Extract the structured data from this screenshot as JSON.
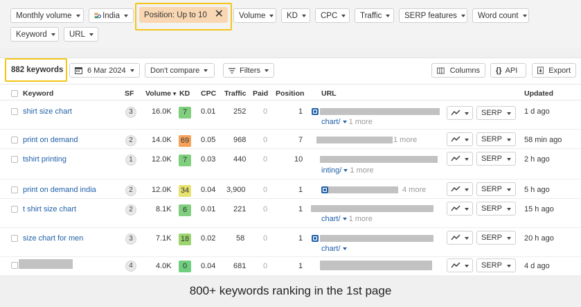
{
  "filters": {
    "monthly_volume": "Monthly volume",
    "country": "India",
    "position": "Position: Up to 10",
    "volume": "Volume",
    "kd": "KD",
    "cpc": "CPC",
    "traffic": "Traffic",
    "serp_features": "SERP features",
    "word_count": "Word count",
    "keyword": "Keyword",
    "url": "URL"
  },
  "toolbar": {
    "keyword_count": "882 keywords",
    "date": "6 Mar 2024",
    "compare": "Don't compare",
    "filters": "Filters",
    "columns": "Columns",
    "api": "API",
    "export": "Export"
  },
  "columns": [
    "Keyword",
    "SF",
    "Volume",
    "KD",
    "CPC",
    "Traffic",
    "Paid",
    "Position",
    "URL",
    "Updated"
  ],
  "rows": [
    {
      "keyword": "shirt size chart",
      "sf": "3",
      "volume": "16.0K",
      "kd": "7",
      "kd_color": "#7fcf7f",
      "cpc": "0.01",
      "traffic": "252",
      "paid": "0",
      "position": "1",
      "url_line2": "chart/",
      "more": "1 more",
      "updated": "1 d ago"
    },
    {
      "keyword": "print on demand",
      "sf": "2",
      "volume": "14.0K",
      "kd": "69",
      "kd_color": "#f5a35c",
      "cpc": "0.05",
      "traffic": "968",
      "paid": "0",
      "position": "7",
      "url_line2": "",
      "more": "1 more",
      "updated": "58 min ago"
    },
    {
      "keyword": "tshirt printing",
      "sf": "1",
      "volume": "12.0K",
      "kd": "7",
      "kd_color": "#7fcf7f",
      "cpc": "0.03",
      "traffic": "440",
      "paid": "0",
      "position": "10",
      "url_line2": "inting/",
      "more": "1 more",
      "updated": "2 h ago"
    },
    {
      "keyword": "print on demand india",
      "sf": "2",
      "volume": "12.0K",
      "kd": "34",
      "kd_color": "#e6e270",
      "cpc": "0.04",
      "traffic": "3,900",
      "paid": "0",
      "position": "1",
      "url_line2": "",
      "more": "4 more",
      "updated": "5 h ago"
    },
    {
      "keyword": "t shirt size chart",
      "sf": "2",
      "volume": "8.1K",
      "kd": "6",
      "kd_color": "#7fcf7f",
      "cpc": "0.01",
      "traffic": "221",
      "paid": "0",
      "position": "1",
      "url_line2": "chart/",
      "more": "1 more",
      "updated": "15 h ago"
    },
    {
      "keyword": "size chart for men",
      "sf": "3",
      "volume": "7.1K",
      "kd": "18",
      "kd_color": "#9bd66f",
      "cpc": "0.02",
      "traffic": "58",
      "paid": "0",
      "position": "1",
      "url_line2": "chart/",
      "more": "",
      "updated": "20 h ago"
    },
    {
      "keyword": "",
      "sf": "4",
      "volume": "4.0K",
      "kd": "0",
      "kd_color": "#6fcf7f",
      "cpc": "0.04",
      "traffic": "681",
      "paid": "0",
      "position": "1",
      "url_line2": "",
      "more": "",
      "updated": "4 d ago"
    }
  ],
  "serp_label": "SERP",
  "footer_caption": "800+ keywords ranking in the 1st page"
}
